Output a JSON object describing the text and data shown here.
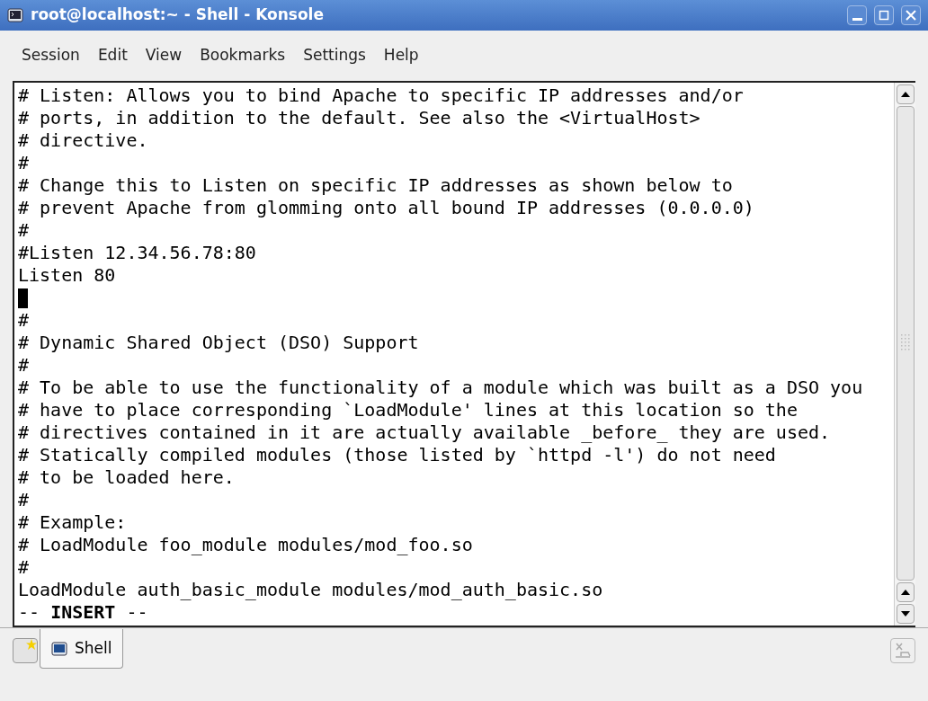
{
  "window": {
    "title": "root@localhost:~ - Shell - Konsole"
  },
  "menu": [
    "Session",
    "Edit",
    "View",
    "Bookmarks",
    "Settings",
    "Help"
  ],
  "terminal": {
    "lines": [
      {
        "kind": "text",
        "text": "# Listen: Allows you to bind Apache to specific IP addresses and/or"
      },
      {
        "kind": "text",
        "text": "# ports, in addition to the default. See also the <VirtualHost>"
      },
      {
        "kind": "text",
        "text": "# directive."
      },
      {
        "kind": "text",
        "text": "#"
      },
      {
        "kind": "text",
        "text": "# Change this to Listen on specific IP addresses as shown below to"
      },
      {
        "kind": "text",
        "text": "# prevent Apache from glomming onto all bound IP addresses (0.0.0.0)"
      },
      {
        "kind": "text",
        "text": "#"
      },
      {
        "kind": "text",
        "text": "#Listen 12.34.56.78:80"
      },
      {
        "kind": "text",
        "text": "Listen 80"
      },
      {
        "kind": "cursor"
      },
      {
        "kind": "text",
        "text": "#"
      },
      {
        "kind": "text",
        "text": "# Dynamic Shared Object (DSO) Support"
      },
      {
        "kind": "text",
        "text": "#"
      },
      {
        "kind": "text",
        "text": "# To be able to use the functionality of a module which was built as a DSO you"
      },
      {
        "kind": "text",
        "text": "# have to place corresponding `LoadModule' lines at this location so the"
      },
      {
        "kind": "text",
        "text": "# directives contained in it are actually available _before_ they are used."
      },
      {
        "kind": "text",
        "text": "# Statically compiled modules (those listed by `httpd -l') do not need"
      },
      {
        "kind": "text",
        "text": "# to be loaded here."
      },
      {
        "kind": "text",
        "text": "#"
      },
      {
        "kind": "text",
        "text": "# Example:"
      },
      {
        "kind": "text",
        "text": "# LoadModule foo_module modules/mod_foo.so"
      },
      {
        "kind": "text",
        "text": "#"
      },
      {
        "kind": "text",
        "text": "LoadModule auth_basic_module modules/mod_auth_basic.so"
      },
      {
        "kind": "text",
        "text": "-- **INSERT** --"
      }
    ]
  },
  "tabs": [
    {
      "label": "Shell",
      "selected": true
    }
  ]
}
